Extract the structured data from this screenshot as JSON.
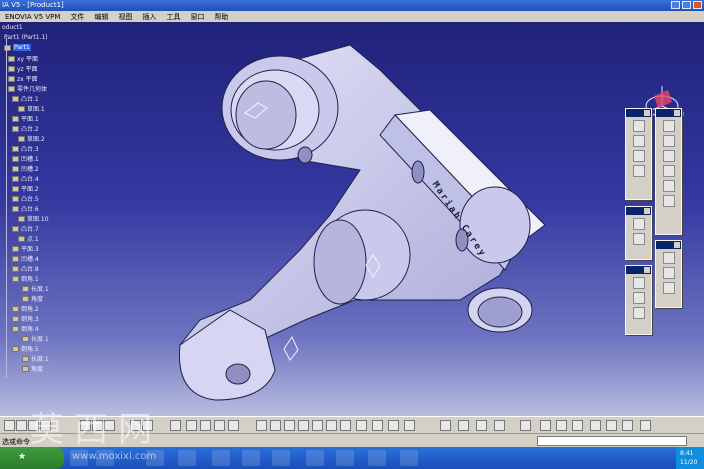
{
  "titlebar": {
    "title": "IA V5 - [Product1]"
  },
  "menubar": {
    "items": [
      "ENOVIA V5 VPM",
      "文件",
      "编辑",
      "视图",
      "插入",
      "工具",
      "窗口",
      "帮助"
    ]
  },
  "tree": {
    "root": "oduct1",
    "part_ref": "Part1 (Part1.1)",
    "nodes": [
      "Part1",
      "xy 平面",
      "yz 平面",
      "zx 平面",
      "零件几何体",
      "凸台.1",
      "草图.1",
      "平面.1",
      "凸台.2",
      "草图.2",
      "凸台.3",
      "凹槽.1",
      "凹槽.2",
      "凸台.4",
      "平面.2",
      "凸台.5",
      "凸台.6",
      "草图.10",
      "凸台.7",
      "点.1",
      "平面.3",
      "凹槽.4",
      "凸台.8",
      "倒角.1",
      "长度.1",
      "角度",
      "倒角.2",
      "倒角.3",
      "倒角.4",
      "长度.1",
      "倒角.5",
      "长度.1",
      "角度"
    ]
  },
  "model_text": "Mariah Carey",
  "prompt": {
    "label": "选或命令"
  },
  "clock": {
    "time": "8:41",
    "date": "11/20"
  },
  "watermark": {
    "text": "莫西网",
    "site": "www.moxixi.com"
  },
  "colors": {
    "viewport_top": "#20227a",
    "viewport_bottom": "#b8bddf",
    "part": "#c9c9ec",
    "selection": "#2f63e8"
  }
}
